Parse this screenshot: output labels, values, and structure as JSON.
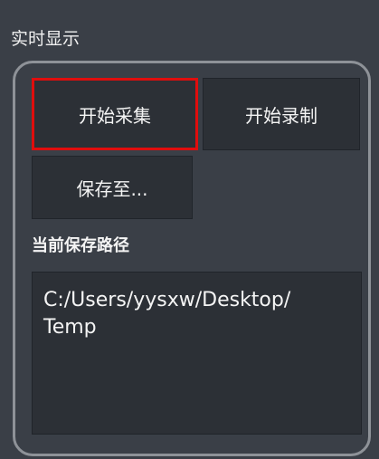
{
  "panel": {
    "title": "实时显示"
  },
  "buttons": {
    "start_capture": "开始采集",
    "start_record": "开始录制",
    "save_to": "保存至..."
  },
  "save_path": {
    "label": "当前保存路径",
    "value": "C:/Users/yysxw/Desktop/\nTemp"
  },
  "colors": {
    "background": "#3a3f47",
    "button_bg": "#2c3036",
    "highlight_border": "#e00d0d",
    "group_border": "#8e9298",
    "text": "#f4f4f4"
  }
}
